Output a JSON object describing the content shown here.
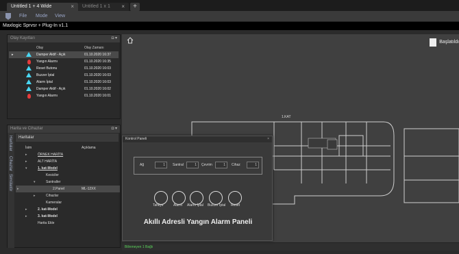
{
  "tabs": [
    {
      "label": "Untitled 1 + 4 Wide",
      "active": true
    },
    {
      "label": "Untitled 1 x 1",
      "active": false
    }
  ],
  "menu": [
    "File",
    "Mode",
    "View"
  ],
  "window_title": "Maxlogic Sprvsr + Plug-In v1.1",
  "olay_panel": {
    "title": "Olay Kayıtları",
    "columns": [
      "Olay",
      "Olay Zamanı"
    ],
    "rows": [
      {
        "icon": "warning",
        "olay": "Damper Aktif - Açık",
        "zaman": "01.10.2020 16:37",
        "selected": true
      },
      {
        "icon": "fire",
        "olay": "Yangın Alarmı",
        "zaman": "01.10.2020 16:35",
        "selected": false
      },
      {
        "icon": "warning",
        "olay": "Reset Butonu",
        "zaman": "01.10.2020 16:03",
        "selected": false
      },
      {
        "icon": "warning",
        "olay": "Buzzer İptal",
        "zaman": "01.10.2020 16:03",
        "selected": false
      },
      {
        "icon": "warning",
        "olay": "Alarm İptal",
        "zaman": "01.10.2020 16:03",
        "selected": false
      },
      {
        "icon": "warning",
        "olay": "Damper Aktif - Açık",
        "zaman": "01.10.2020 16:02",
        "selected": false
      },
      {
        "icon": "fire",
        "olay": "Yangın Alarmı",
        "zaman": "01.10.2020 16:01",
        "selected": false
      }
    ]
  },
  "harita_panel": {
    "title": "Harita ve Cihazlar",
    "side_tabs": [
      "Haritalar",
      "Cihazlar",
      "Simülatör"
    ],
    "subheader": "Haritalar",
    "columns": [
      "İsim",
      "Açıklama"
    ],
    "tree": [
      {
        "label": "ÖRNEK HARİTA",
        "indent": 1,
        "expander": "▸",
        "bold": false,
        "underline": true,
        "aciklama": ""
      },
      {
        "label": "ALT HARİTA",
        "indent": 1,
        "expander": "▸",
        "bold": false,
        "underline": false,
        "aciklama": ""
      },
      {
        "label": "1. kat-Model",
        "indent": 1,
        "expander": "▾",
        "bold": true,
        "underline": true,
        "aciklama": ""
      },
      {
        "label": "Kesiciler",
        "indent": 2,
        "expander": "",
        "bold": false,
        "underline": false,
        "aciklama": ""
      },
      {
        "label": "Santraller",
        "indent": 2,
        "expander": "▾",
        "bold": false,
        "underline": false,
        "aciklama": ""
      },
      {
        "label": "2.Panel",
        "indent": 3,
        "expander": "",
        "bold": false,
        "underline": false,
        "aciklama": "ML-12XX",
        "selected": true
      },
      {
        "label": "Cihazlar",
        "indent": 2,
        "expander": "▸",
        "bold": false,
        "underline": false,
        "aciklama": ""
      },
      {
        "label": "Kameralar",
        "indent": 2,
        "expander": "",
        "bold": false,
        "underline": false,
        "aciklama": ""
      },
      {
        "label": "2. kat-Model",
        "indent": 1,
        "expander": "▸",
        "bold": true,
        "underline": false,
        "aciklama": ""
      },
      {
        "label": "3. kat-Model",
        "indent": 1,
        "expander": "▸",
        "bold": true,
        "underline": false,
        "aciklama": ""
      },
      {
        "label": "Harita Ekle",
        "indent": 1,
        "expander": "",
        "bold": false,
        "underline": false,
        "aciklama": ""
      }
    ]
  },
  "main": {
    "top_right_button": "Başlatıldı",
    "floor_label": "1.KAT",
    "status_text": "Bilinmeyen 1 Bağlı"
  },
  "dialog": {
    "title": "Kontrol Paneli",
    "fields": [
      {
        "label": "Ağ",
        "value": "1"
      },
      {
        "label": "Santral",
        "value": "1"
      },
      {
        "label": "Çevrim",
        "value": "1"
      },
      {
        "label": "Cihaz",
        "value": "1"
      }
    ],
    "buttons": [
      "Tahliye",
      "Alarm",
      "Alarm İptal",
      "Buzzer İptal",
      "Reset"
    ],
    "heading": "Akıllı Adresli Yangın Alarm Paneli"
  },
  "colors": {
    "warning_icon": "#49d6f2",
    "fire_icon": "#e53b3b",
    "status_green": "#5ad05a",
    "menu_text": "#9aa6c8"
  }
}
